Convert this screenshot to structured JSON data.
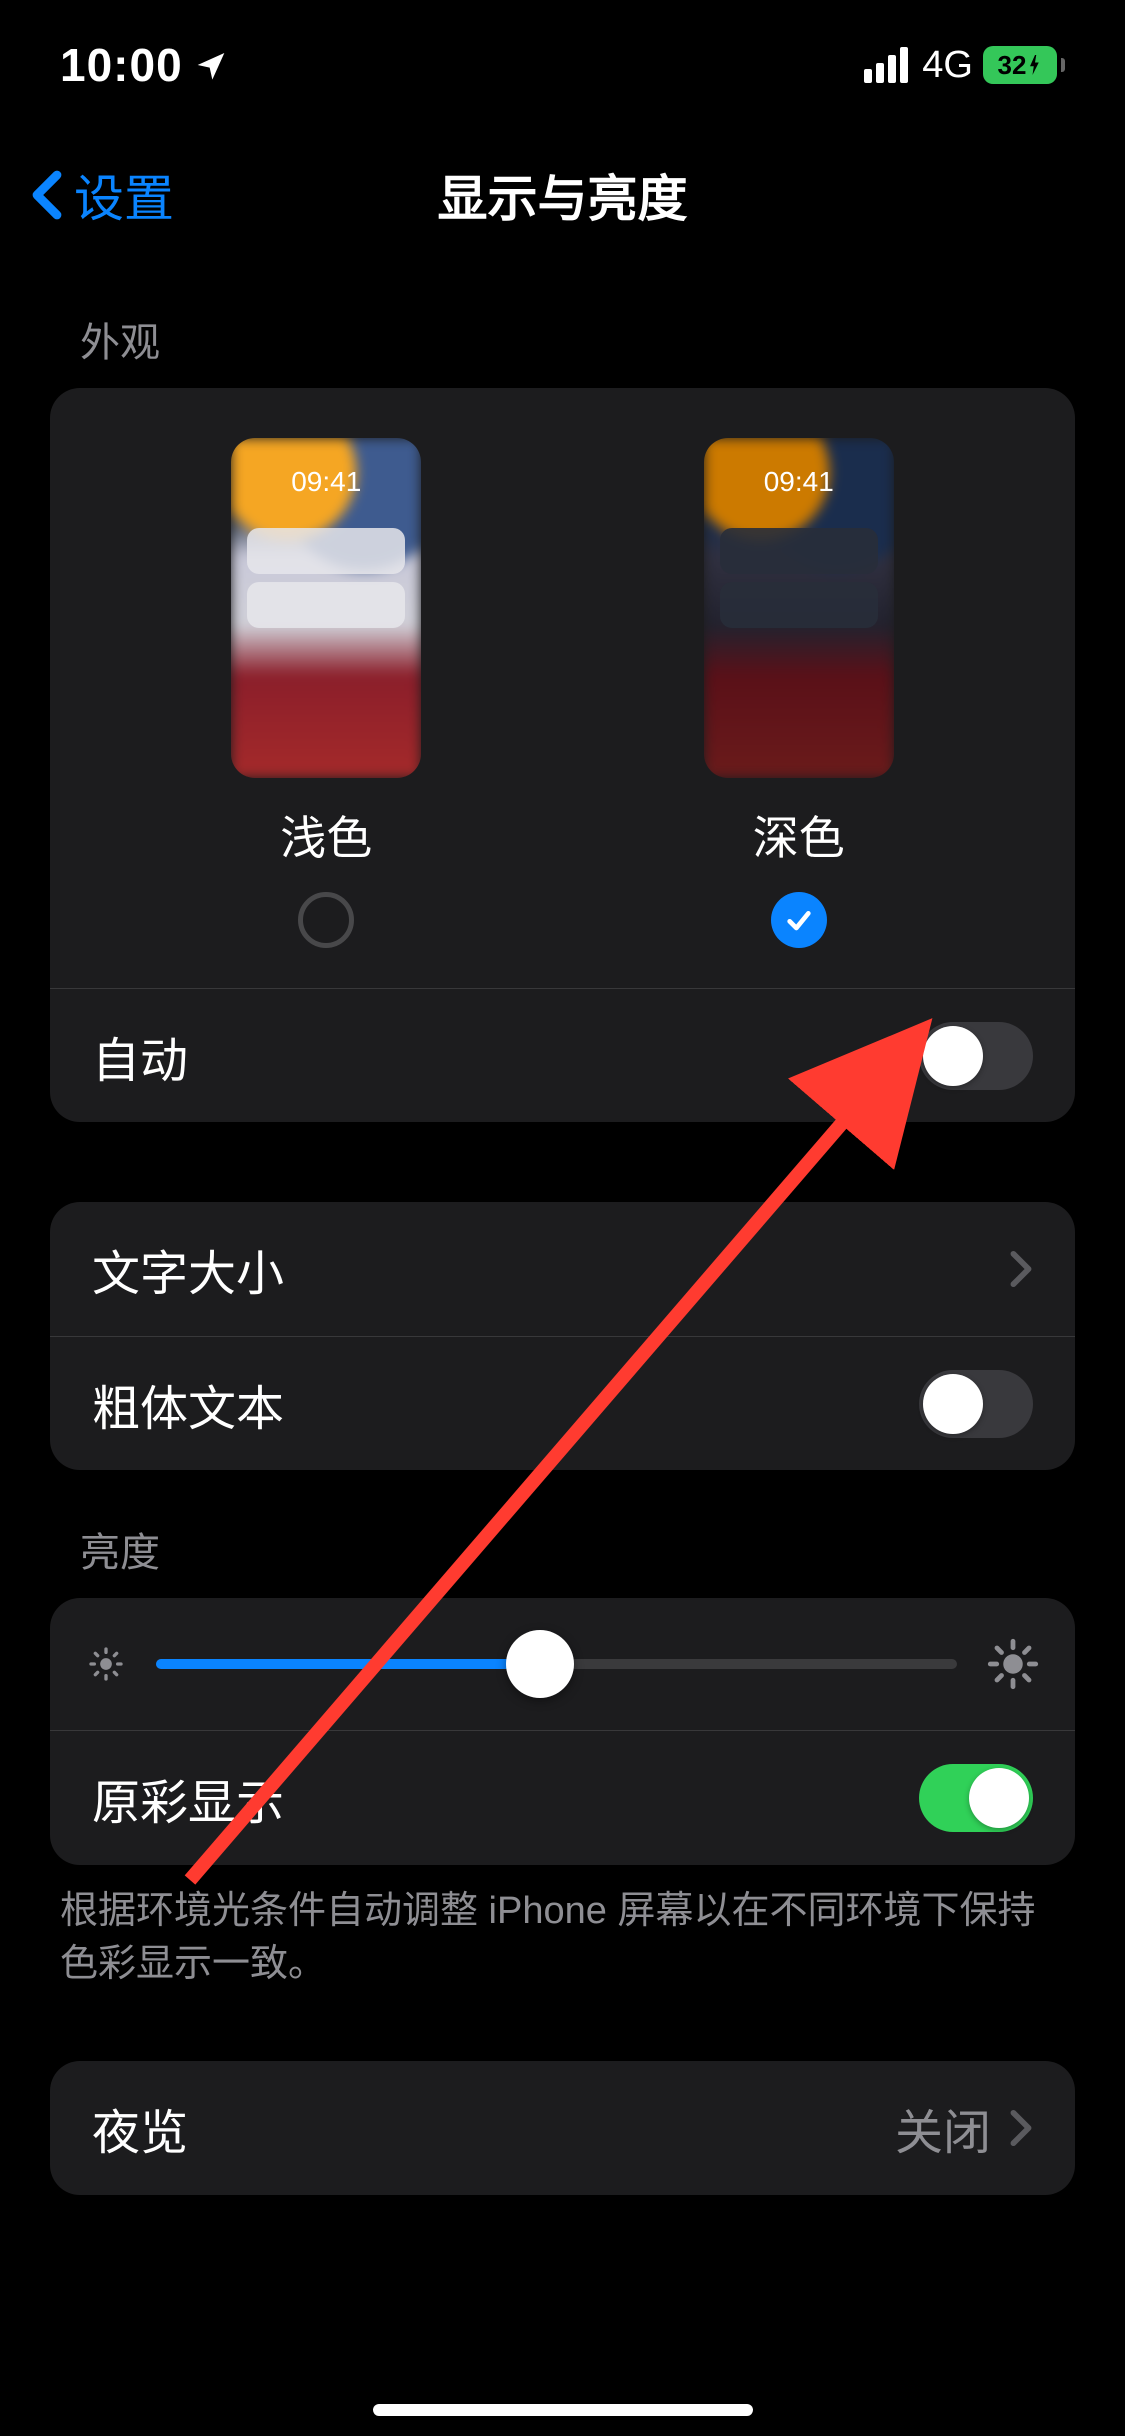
{
  "statusBar": {
    "time": "10:00",
    "network": "4G",
    "battery": "32"
  },
  "nav": {
    "back": "设置",
    "title": "显示与亮度"
  },
  "appearance": {
    "header": "外观",
    "previewTime": "09:41",
    "light": "浅色",
    "dark": "深色",
    "selected": "dark",
    "auto": "自动",
    "autoOn": false
  },
  "text": {
    "textSize": "文字大小",
    "boldText": "粗体文本",
    "boldOn": false
  },
  "brightness": {
    "header": "亮度",
    "value": 0.48,
    "trueTone": "原彩显示",
    "trueToneOn": true,
    "footer": "根据环境光条件自动调整 iPhone 屏幕以在不同环境下保持色彩显示一致。"
  },
  "nightShift": {
    "label": "夜览",
    "value": "关闭"
  }
}
